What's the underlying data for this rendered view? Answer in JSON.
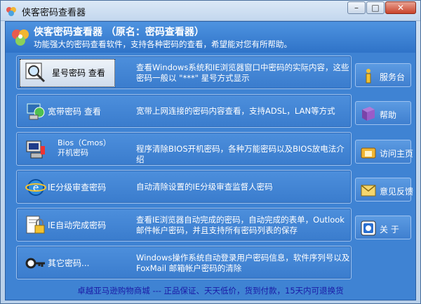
{
  "window": {
    "title": "侠客密码查看器",
    "buttons": {
      "min": "–",
      "max": "□",
      "close": "✕"
    }
  },
  "header": {
    "title": "侠客密码查看器 （原名：密码查看器）",
    "subtitle": "功能强大的密码查看软件，支持各种密码的查看，希望能对您有所帮助。"
  },
  "items": [
    {
      "name": "星号密码 查看",
      "desc": "查看Windows系统和IE浏览器窗口中密码的实际内容，这些密码一般以 \"***\" 星号方式显示",
      "icon": "magnifier-icon"
    },
    {
      "name": "宽带密码 查看",
      "desc": "宽带上网连接的密码内容查看，支持ADSL，LAN等方式",
      "icon": "network-icon"
    },
    {
      "name_line1": "Bios（Cmos）",
      "name_line2": "开机密码",
      "desc": "程序清除BIOS开机密码，各种万能密码以及BIOS放电法介绍",
      "icon": "computer-icon"
    },
    {
      "name": "IE分级审查密码",
      "desc": "自动清除设置的IE分级审查监督人密码",
      "icon": "ie-icon"
    },
    {
      "name": "IE自动完成密码",
      "desc": "查看IE浏览器自动完成的密码，自动完成的表单，Outlook邮件帐户密码，并且支持所有密码列表的保存",
      "icon": "lock-icon"
    },
    {
      "name": "其它密码...",
      "desc": "Windows操作系统自动登录用户密码信息，软件序列号以及FoxMail 邮箱帐户密码的清除",
      "icon": "key-icon"
    }
  ],
  "side": [
    {
      "label": "服务台",
      "icon": "info-icon"
    },
    {
      "label": "帮助",
      "icon": "help-book-icon"
    },
    {
      "label": "访问主页",
      "icon": "home-icon"
    },
    {
      "label": "意见反馈",
      "icon": "mail-icon"
    },
    {
      "label": "关 于",
      "icon": "about-icon"
    }
  ],
  "footer": "卓越亚马逊购物商城 --- 正品保证、天天低价，货到付款，15天内可退换货"
}
